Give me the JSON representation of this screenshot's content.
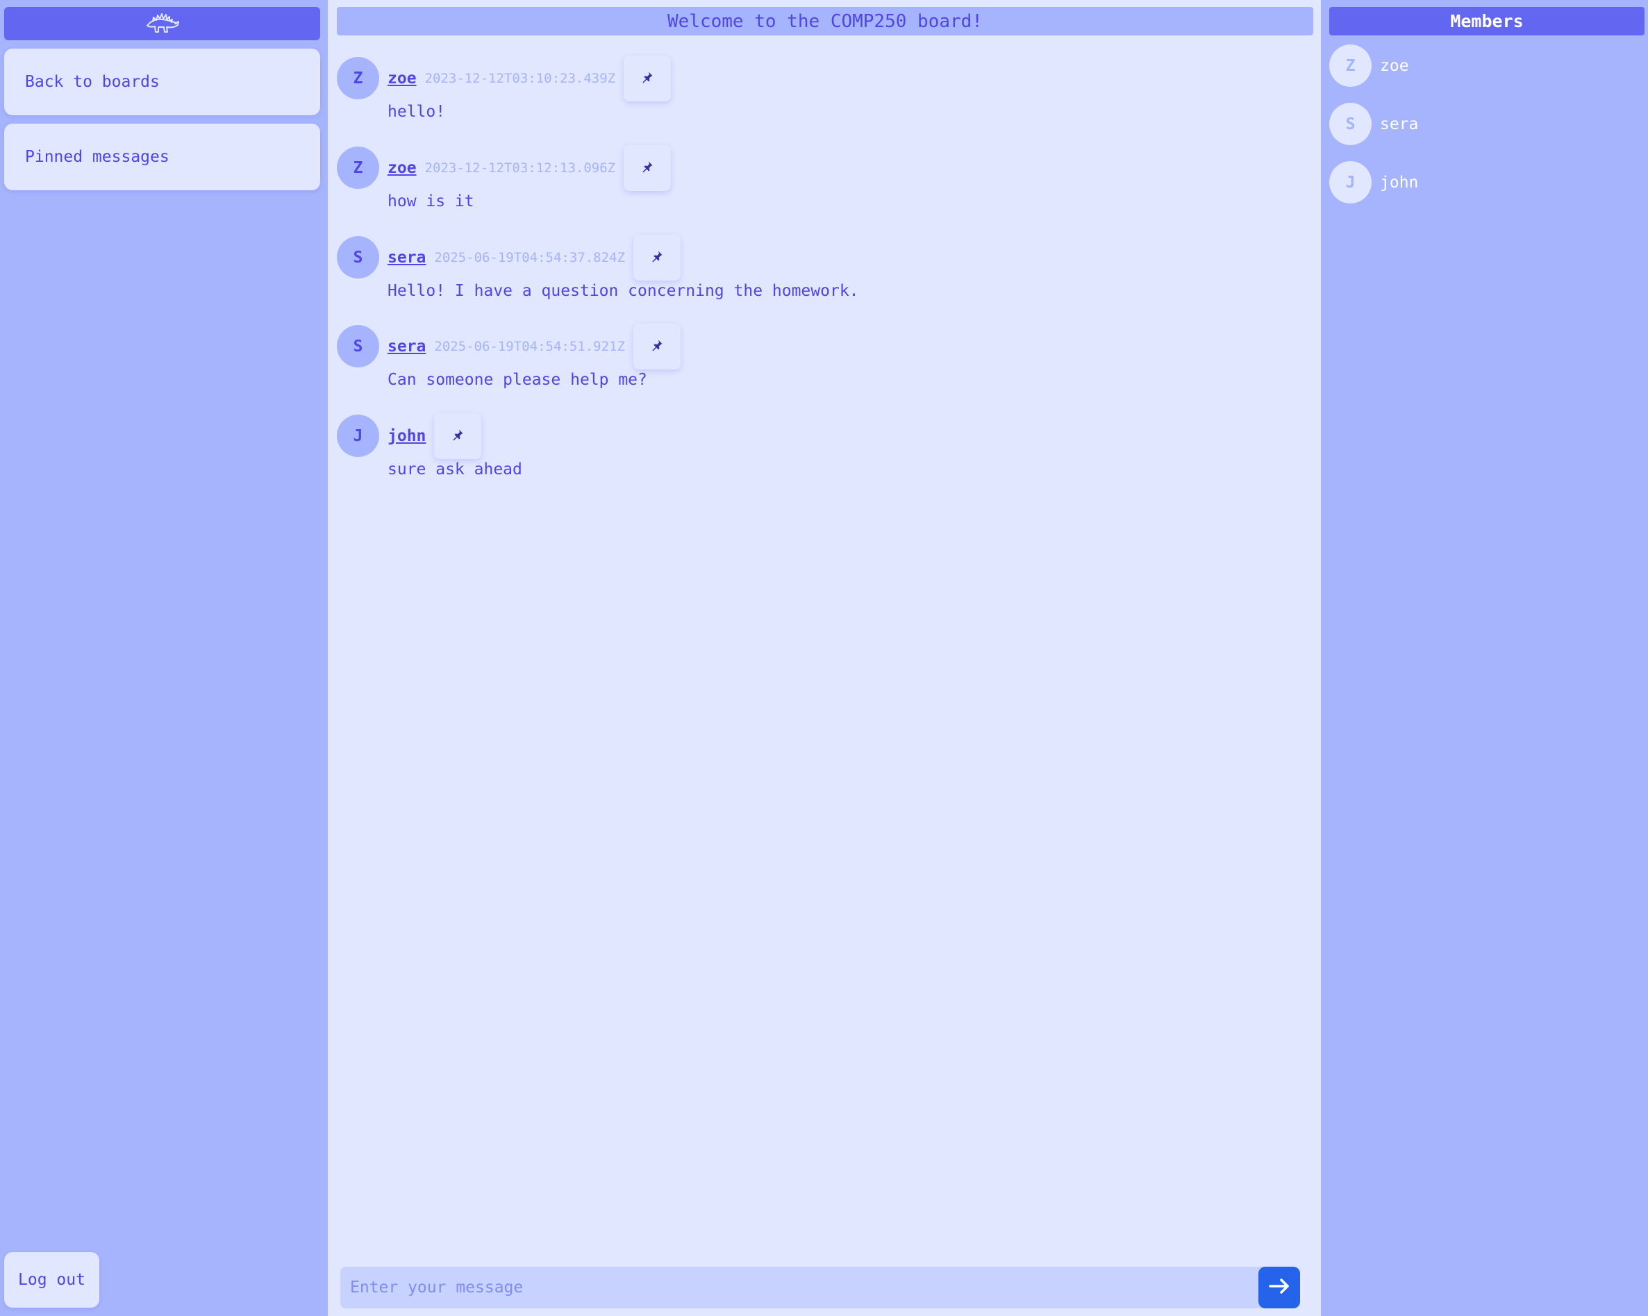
{
  "sidebar": {
    "logo_icon": "stegosaurus-logo-icon",
    "back_label": "Back to boards",
    "pinned_label": "Pinned messages",
    "logout_label": "Log out"
  },
  "board": {
    "title": "Welcome to the COMP250 board!"
  },
  "messages": [
    {
      "initial": "Z",
      "author": "zoe",
      "time": "2023-12-12T03:10:23.439Z",
      "text": "hello!"
    },
    {
      "initial": "Z",
      "author": "zoe",
      "time": "2023-12-12T03:12:13.096Z",
      "text": "how is it"
    },
    {
      "initial": "S",
      "author": "sera",
      "time": "2025-06-19T04:54:37.824Z",
      "text": "Hello! I have a question concerning the homework."
    },
    {
      "initial": "S",
      "author": "sera",
      "time": "2025-06-19T04:54:51.921Z",
      "text": "Can someone please help me?"
    },
    {
      "initial": "J",
      "author": "john",
      "time": "",
      "text": "sure ask ahead"
    }
  ],
  "composer": {
    "placeholder": "Enter your message",
    "send_icon": "arrow-right-icon"
  },
  "members": {
    "title": "Members",
    "list": [
      {
        "initial": "Z",
        "name": "zoe"
      },
      {
        "initial": "S",
        "name": "sera"
      },
      {
        "initial": "J",
        "name": "john"
      }
    ]
  },
  "colors": {
    "accent": "#6366f1",
    "panel": "#a5b4fc",
    "surface": "#e0e7ff",
    "text": "#4f46e5",
    "send": "#2563eb"
  }
}
